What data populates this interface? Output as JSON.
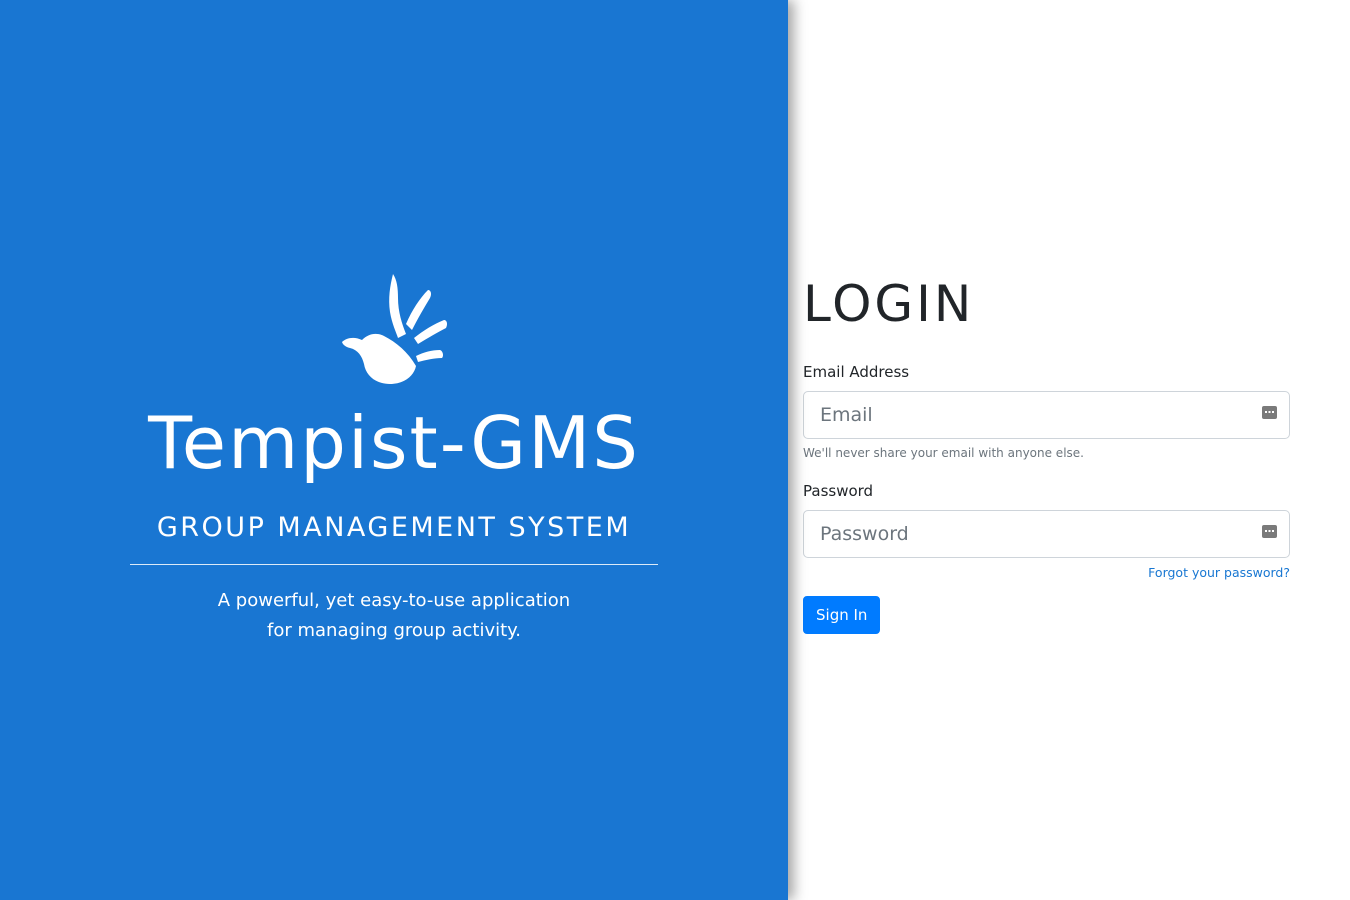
{
  "brand": {
    "logo": "hand-dove-logo",
    "title": "Tempist-GMS",
    "subtitle": "GROUP MANAGEMENT SYSTEM",
    "tagline_line1": "A powerful, yet easy-to-use application",
    "tagline_line2": "for managing group activity.",
    "background_color": "#1976d2"
  },
  "login": {
    "heading": "LOGIN",
    "email": {
      "label": "Email Address",
      "placeholder": "Email",
      "value": "",
      "help": "We'll never share your email with anyone else.",
      "icon": "password-manager-icon"
    },
    "password": {
      "label": "Password",
      "placeholder": "Password",
      "value": "",
      "icon": "password-manager-icon"
    },
    "forgot_label": "Forgot your password?",
    "submit_label": "Sign In",
    "accent_color": "#007bff"
  }
}
